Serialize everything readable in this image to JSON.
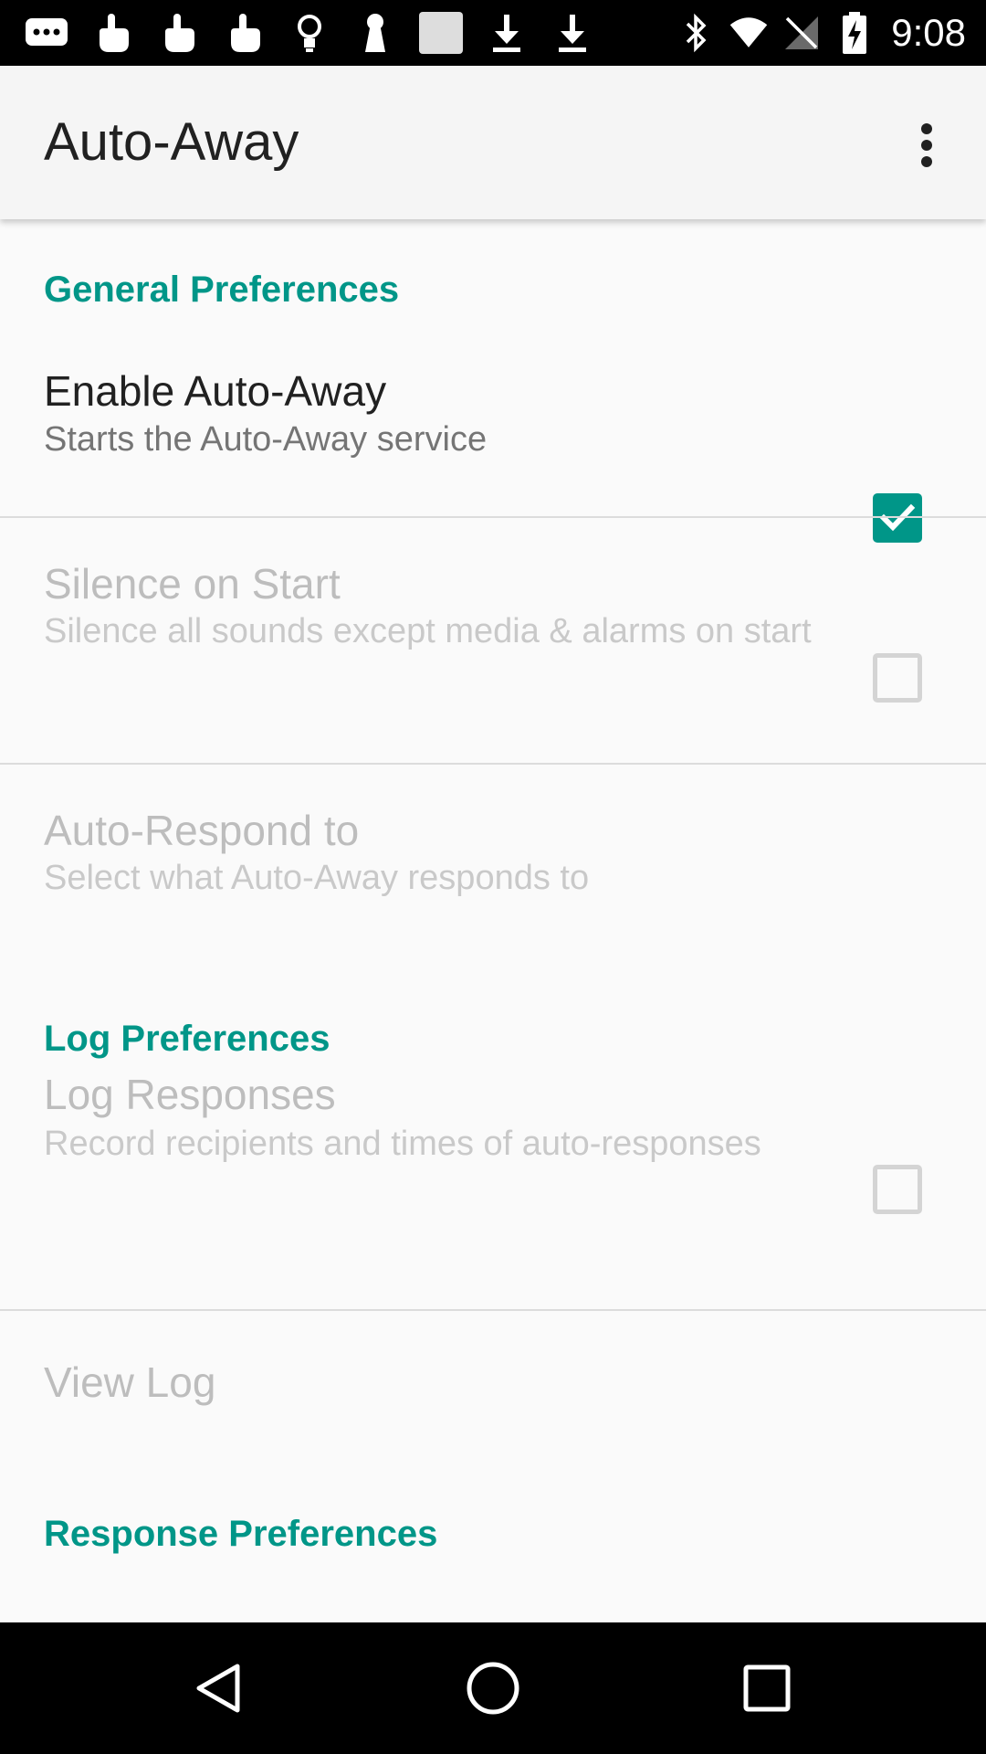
{
  "status_bar": {
    "time": "9:08",
    "left_icons": [
      "message-icon",
      "touch-icon",
      "touch-icon",
      "touch-icon",
      "lightbulb-icon",
      "keyhole-icon",
      "image-icon",
      "download-icon",
      "download-icon"
    ],
    "right_icons": [
      "bluetooth-icon",
      "wifi-icon",
      "no-signal-icon",
      "battery-charging-icon"
    ]
  },
  "app_bar": {
    "title": "Auto-Away",
    "overflow_icon": "more-vert-icon"
  },
  "sections": {
    "general": {
      "header": "General Preferences",
      "enable": {
        "title": "Enable Auto-Away",
        "summary": "Starts the Auto-Away service",
        "checked": true
      },
      "silence": {
        "title": "Silence on Start",
        "summary": "Silence all sounds except media & alarms on start",
        "checked": false
      },
      "respond": {
        "title": "Auto-Respond to",
        "summary": "Select what Auto-Away responds to"
      }
    },
    "log": {
      "header": "Log Preferences",
      "log_responses": {
        "title": "Log Responses",
        "summary": "Record recipients and times of auto-responses",
        "checked": false
      },
      "view_log": {
        "title": "View Log"
      }
    },
    "response": {
      "header": "Response Preferences"
    }
  },
  "nav_bar": {
    "back_icon": "back-icon",
    "home_icon": "home-icon",
    "recents_icon": "recents-icon"
  },
  "colors": {
    "accent": "#009688",
    "status_bar": "#000000",
    "app_bar": "#f5f5f5",
    "background": "#fafafa"
  }
}
